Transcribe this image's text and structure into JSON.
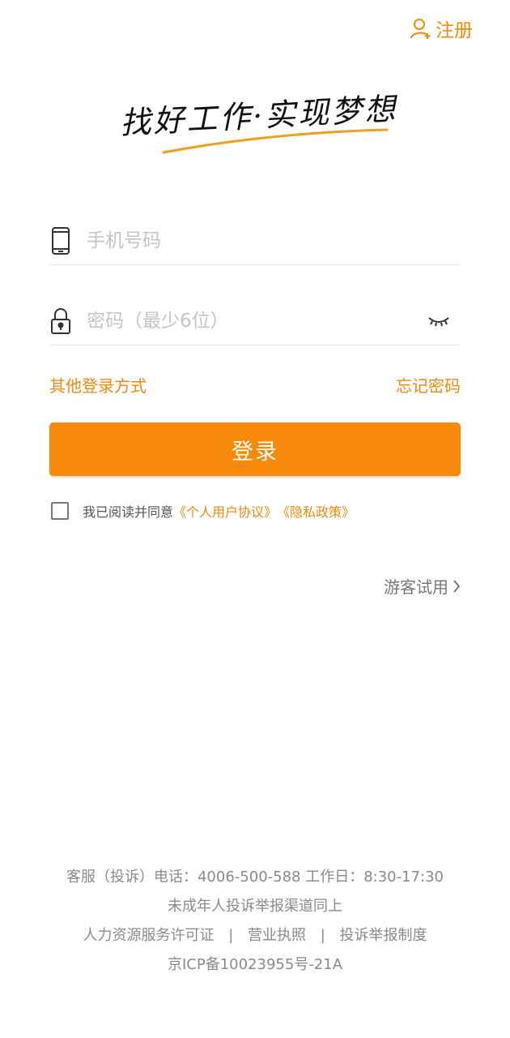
{
  "header": {
    "register_label": "注册",
    "register_icon": "user-add-icon"
  },
  "slogan": {
    "text": "找好工作·实现梦想",
    "underline_color": "#f0a020"
  },
  "form": {
    "phone": {
      "icon": "phone-icon",
      "value": "",
      "placeholder": "手机号码"
    },
    "password": {
      "icon": "lock-icon",
      "value": "",
      "placeholder": "密码（最少6位）",
      "toggle_icon": "eye-closed-icon"
    },
    "other_login": "其他登录方式",
    "forgot_password": "忘记密码",
    "login_label": "登录"
  },
  "agreement": {
    "prefix": "我已阅读并同意",
    "user_agreement": "《个人用户协议》",
    "privacy_policy": "《隐私政策》",
    "checked": false
  },
  "guest": {
    "label": "游客试用",
    "icon": "chevron-right-icon"
  },
  "footer": {
    "line1": "客服（投诉）电话：4006-500-588 工作日：8:30-17:30",
    "line2": "未成年人投诉举报渠道同上",
    "license": "人力资源服务许可证",
    "business": "营业执照",
    "report": "投诉举报制度",
    "separator": "|",
    "icp": "京ICP备10023955号-21A"
  },
  "colors": {
    "accent": "#f78a0a",
    "link": "#f08a0c"
  }
}
